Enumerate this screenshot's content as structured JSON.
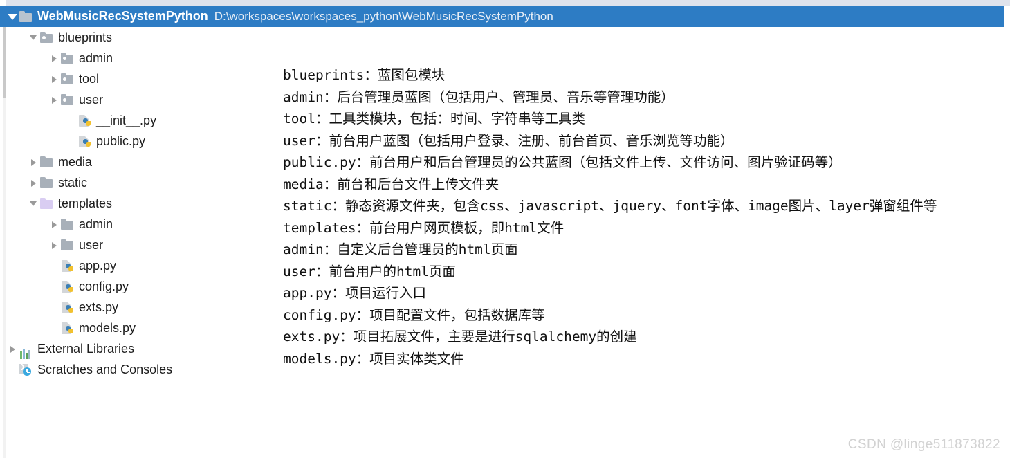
{
  "window": {
    "top_strip_color": "#dfe3ec"
  },
  "project_tree": {
    "header": {
      "name": "WebMusicRecSystemPython",
      "path": "D:\\workspaces\\workspaces_python\\WebMusicRecSystemPython",
      "expanded_icon": "triangle-down-icon",
      "folder_icon": "folder-icon",
      "background_color": "#2d7cc4"
    },
    "items": [
      {
        "label": "blueprints",
        "icon": "python-package-folder-icon",
        "arrow": "triangle-down-icon",
        "indent": 2
      },
      {
        "label": "admin",
        "icon": "python-package-folder-icon",
        "arrow": "triangle-right-icon",
        "indent": 3
      },
      {
        "label": "tool",
        "icon": "python-package-folder-icon",
        "arrow": "triangle-right-icon",
        "indent": 3
      },
      {
        "label": "user",
        "icon": "python-package-folder-icon",
        "arrow": "triangle-right-icon",
        "indent": 3
      },
      {
        "label": "__init__.py",
        "icon": "python-file-icon",
        "arrow": "none",
        "indent": 4
      },
      {
        "label": "public.py",
        "icon": "python-file-icon",
        "arrow": "none",
        "indent": 4
      },
      {
        "label": "media",
        "icon": "folder-icon",
        "arrow": "triangle-right-icon",
        "indent": 2
      },
      {
        "label": "static",
        "icon": "folder-icon",
        "arrow": "triangle-right-icon",
        "indent": 2
      },
      {
        "label": "templates",
        "icon": "templates-folder-icon",
        "arrow": "triangle-down-icon",
        "indent": 2
      },
      {
        "label": "admin",
        "icon": "folder-icon",
        "arrow": "triangle-right-icon",
        "indent": 3
      },
      {
        "label": "user",
        "icon": "folder-icon",
        "arrow": "triangle-right-icon",
        "indent": 3
      },
      {
        "label": "app.py",
        "icon": "python-file-icon",
        "arrow": "none",
        "indent": 3
      },
      {
        "label": "config.py",
        "icon": "python-file-icon",
        "arrow": "none",
        "indent": 3
      },
      {
        "label": "exts.py",
        "icon": "python-file-icon",
        "arrow": "none",
        "indent": 3
      },
      {
        "label": "models.py",
        "icon": "python-file-icon",
        "arrow": "none",
        "indent": 3
      },
      {
        "label": "External Libraries",
        "icon": "external-libraries-icon",
        "arrow": "triangle-right-icon",
        "indent": 1
      },
      {
        "label": "Scratches and Consoles",
        "icon": "scratches-icon",
        "arrow": "none",
        "indent": 1
      }
    ]
  },
  "description": {
    "lines": [
      "blueprints：蓝图包模块",
      "admin：后台管理员蓝图（包括用户、管理员、音乐等管理功能）",
      "tool：工具类模块，包括：时间、字符串等工具类",
      "user：前台用户蓝图（包括用户登录、注册、前台首页、音乐浏览等功能）",
      "public.py：前台用户和后台管理员的公共蓝图（包括文件上传、文件访问、图片验证码等）",
      "media：前台和后台文件上传文件夹",
      "static：静态资源文件夹，包含css、javascript、jquery、font字体、image图片、layer弹窗组件等",
      "templates：前台用户网页模板，即html文件",
      "admin：自定义后台管理员的html页面",
      "user：前台用户的html页面",
      "app.py：项目运行入口",
      "config.py：项目配置文件，包括数据库等",
      "exts.py：项目拓展文件，主要是进行sqlalchemy的创建",
      "models.py：项目实体类文件"
    ]
  },
  "watermark": {
    "text": "CSDN @linge511873822"
  }
}
